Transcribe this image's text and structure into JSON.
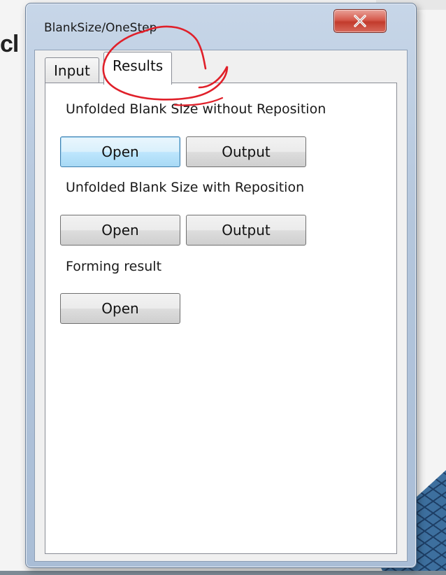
{
  "background": {
    "title_fragment": "cl"
  },
  "window": {
    "title": "BlankSize/OneStep",
    "close_icon": "close-x-icon"
  },
  "tabs": [
    {
      "label": "Input",
      "selected": false
    },
    {
      "label": "Results",
      "selected": true
    }
  ],
  "results": {
    "sections": [
      {
        "label": "Unfolded Blank Size without Reposition",
        "open_label": "Open",
        "output_label": "Output"
      },
      {
        "label": "Unfolded Blank Size with Reposition",
        "open_label": "Open",
        "output_label": "Output"
      },
      {
        "label": "Forming result",
        "open_label": "Open"
      }
    ]
  },
  "colors": {
    "annotation_stroke": "#e0202a",
    "focus_border": "#3c7fb1",
    "close_button": "#c23b2c"
  }
}
